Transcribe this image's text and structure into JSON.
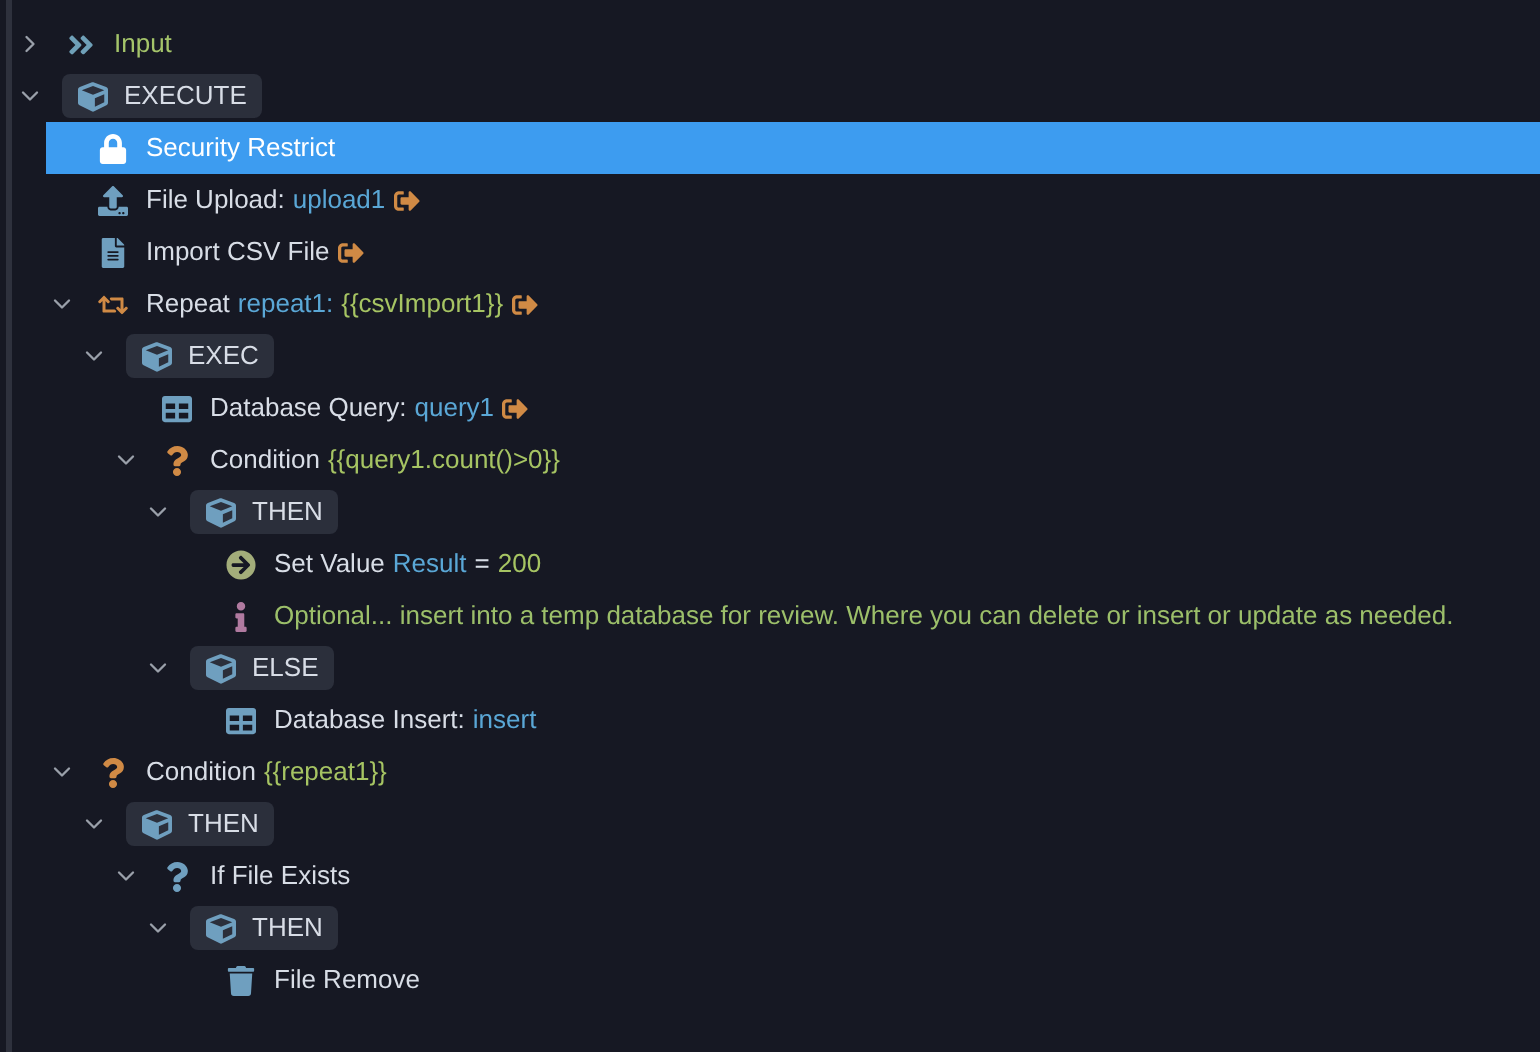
{
  "tree": [
    {
      "kind": "input",
      "label": "Input",
      "selected": false,
      "expanded": false
    },
    {
      "kind": "block",
      "label": "EXECUTE",
      "selected": false,
      "expanded": true,
      "children": [
        {
          "kind": "lock",
          "label": "Security Restrict",
          "selected": true
        },
        {
          "kind": "upload",
          "label": "File Upload:",
          "parts": [
            {
              "kind": "var",
              "text": "upload1"
            }
          ],
          "link": true,
          "selected": false
        },
        {
          "kind": "file",
          "label": "Import CSV File",
          "link": true,
          "selected": false
        },
        {
          "kind": "repeat",
          "label": "Repeat",
          "parts": [
            {
              "kind": "var",
              "text": "repeat1:"
            },
            {
              "kind": "expr",
              "text": "{{csvImport1}}"
            }
          ],
          "link": true,
          "selected": false,
          "expanded": true,
          "children": [
            {
              "kind": "block",
              "label": "EXEC",
              "selected": false,
              "expanded": true,
              "children": [
                {
                  "kind": "query",
                  "label": "Database Query:",
                  "parts": [
                    {
                      "kind": "var",
                      "text": "query1"
                    }
                  ],
                  "link": true,
                  "selected": false
                },
                {
                  "kind": "condition",
                  "label": "Condition",
                  "parts": [
                    {
                      "kind": "expr",
                      "text": "{{query1.count()>0}}"
                    }
                  ],
                  "selected": false,
                  "expanded": true,
                  "children": [
                    {
                      "kind": "block",
                      "label": "THEN",
                      "selected": false,
                      "expanded": true,
                      "children": [
                        {
                          "kind": "setvalue",
                          "label": "Set Value",
                          "parts": [
                            {
                              "kind": "var",
                              "text": "Result"
                            },
                            {
                              "kind": "plain",
                              "text": "="
                            },
                            {
                              "kind": "expr",
                              "text": "200"
                            }
                          ],
                          "selected": false
                        },
                        {
                          "kind": "comment",
                          "label": "Optional... insert into a temp database for review. Where you can delete or insert or update as needed.",
                          "selected": false
                        }
                      ]
                    },
                    {
                      "kind": "block",
                      "label": "ELSE",
                      "selected": false,
                      "expanded": true,
                      "children": [
                        {
                          "kind": "insert",
                          "label": "Database Insert:",
                          "parts": [
                            {
                              "kind": "var",
                              "text": "insert"
                            }
                          ],
                          "selected": false
                        }
                      ]
                    }
                  ]
                }
              ]
            }
          ]
        },
        {
          "kind": "condition",
          "label": "Condition",
          "parts": [
            {
              "kind": "expr",
              "text": "{{repeat1}}"
            }
          ],
          "selected": false,
          "expanded": true,
          "children": [
            {
              "kind": "block",
              "label": "THEN",
              "selected": false,
              "expanded": true,
              "children": [
                {
                  "kind": "exists",
                  "label": "If File Exists",
                  "selected": false,
                  "expanded": true,
                  "children": [
                    {
                      "kind": "block",
                      "label": "THEN",
                      "selected": false,
                      "expanded": true,
                      "children": [
                        {
                          "kind": "remove",
                          "label": "File Remove",
                          "selected": false
                        }
                      ]
                    }
                  ]
                }
              ]
            }
          ]
        }
      ]
    }
  ]
}
